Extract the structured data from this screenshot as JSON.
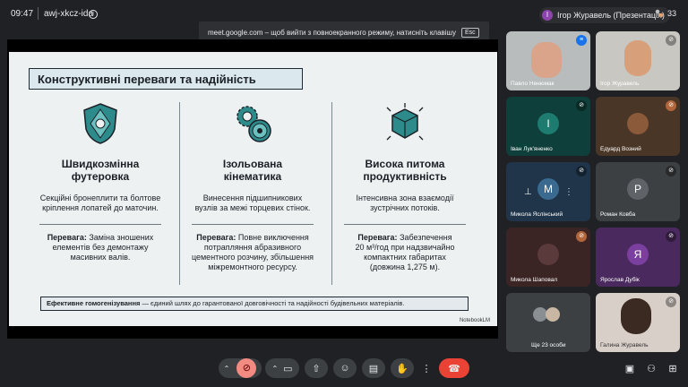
{
  "topbar": {
    "time": "09:47",
    "meeting_code": "awj-xkcz-ida",
    "presenter_initial": "І",
    "presenter_label": "Ігор Журавель (Презентація)",
    "people_count": "33"
  },
  "toast": {
    "text": "meet.google.com – щоб вийти з повноекранного режиму, натисніть клавішу",
    "key": "Esc"
  },
  "slide": {
    "title": "Конструктивні переваги та надійність",
    "columns": [
      {
        "icon": "shield-icon",
        "heading_line1": "Швидкозмінна",
        "heading_line2": "футеровка",
        "desc_line1": "Секційні бронеплити та болтове",
        "desc_line2": "кріплення лопатей до маточин.",
        "benefit_label": "Перевага:",
        "benefit_line1": " Заміна зношених",
        "benefit_line2": "елементів без демонтажу",
        "benefit_line3": "масивних валів."
      },
      {
        "icon": "gears-icon",
        "heading_line1": "Ізольована",
        "heading_line2": "кінематика",
        "desc_line1": "Винесення підшипникових",
        "desc_line2": "вузлів за межі торцевих стінок.",
        "benefit_label": "Перевага:",
        "benefit_line1": " Повне виключення",
        "benefit_line2": "потрапляння абразивного",
        "benefit_line3": "цементного розчину, збільшення",
        "benefit_line4": "міжремонтного ресурсу."
      },
      {
        "icon": "cube-icon",
        "heading_line1": "Висока питома",
        "heading_line2": "продуктивність",
        "desc_line1": "Інтенсивна зона взаємодії",
        "desc_line2": "зустрічних потоків.",
        "benefit_label": "Перевага:",
        "benefit_line1": " Забезпечення",
        "benefit_line2": "20 м³/год при надзвичайно",
        "benefit_line3": "компактних габаритах",
        "benefit_line4": "(довжина 1,275 м)."
      }
    ],
    "footer_bold": "Ефективне гомогенізування",
    "footer_rest": " — єдиний шлях до гарантованої довговічності та надійності будівельних матеріалів.",
    "watermark": "NotebookLM"
  },
  "participants": [
    {
      "name": "Павло Ненюмак",
      "type": "video"
    },
    {
      "name": "Ігор Журавель",
      "type": "video"
    },
    {
      "name": "Іван Лук'яненко",
      "initial": "І",
      "color": "#1e7b70"
    },
    {
      "name": "Едуард Возний",
      "type": "photo",
      "color": "#8a5a3a"
    },
    {
      "name": "Микола Яслінський",
      "initial": "М",
      "color": "#3a6a90"
    },
    {
      "name": "Роман Ковба",
      "initial": "Р",
      "color": "#5f6368"
    },
    {
      "name": "Микола Шаповал",
      "type": "photo",
      "color": "#5a3a3a"
    },
    {
      "name": "Ярослав Дубік",
      "initial": "Я",
      "color": "#7b3fa0"
    },
    {
      "name": "Ще 23 особи",
      "type": "more"
    },
    {
      "name": "Галина Журавель",
      "type": "video"
    }
  ],
  "colors": {
    "accent_red": "#ea4335",
    "slide_teal": "#2e8b8b"
  }
}
